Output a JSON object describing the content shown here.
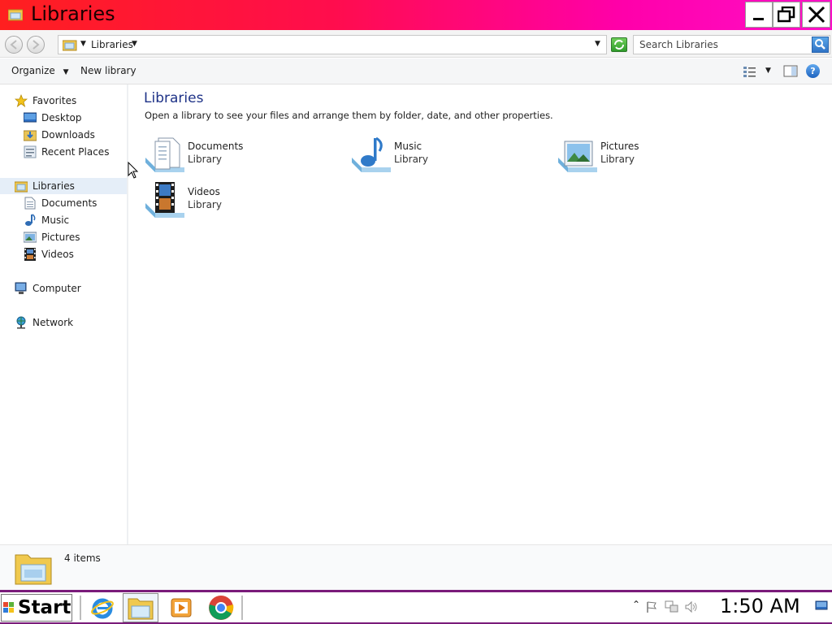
{
  "window": {
    "title": "Libraries",
    "title_gradient": [
      "#ff1f1f",
      "#ff10c8"
    ]
  },
  "address": {
    "path": "Libraries",
    "search_placeholder": "Search Libraries"
  },
  "toolbar": {
    "organize": "Organize",
    "new_library": "New library"
  },
  "nav": {
    "favorites": "Favorites",
    "favorites_items": [
      "Desktop",
      "Downloads",
      "Recent Places"
    ],
    "libraries": "Libraries",
    "libraries_items": [
      "Documents",
      "Music",
      "Pictures",
      "Videos"
    ],
    "computer": "Computer",
    "network": "Network"
  },
  "content": {
    "title": "Libraries",
    "description": "Open a library to see your files and arrange them by folder, date, and other properties.",
    "libraries": [
      {
        "name": "Documents",
        "sub": "Library",
        "icon": "documents-library-icon"
      },
      {
        "name": "Music",
        "sub": "Library",
        "icon": "music-library-icon"
      },
      {
        "name": "Pictures",
        "sub": "Library",
        "icon": "pictures-library-icon"
      },
      {
        "name": "Videos",
        "sub": "Library",
        "icon": "videos-library-icon"
      }
    ]
  },
  "status": {
    "count": "4 items"
  },
  "taskbar": {
    "start": "Start",
    "apps": [
      "internet-explorer-icon",
      "windows-explorer-icon",
      "media-player-icon",
      "chrome-icon"
    ],
    "clock": "1:50 AM",
    "border_color": "#7a1b7a"
  }
}
